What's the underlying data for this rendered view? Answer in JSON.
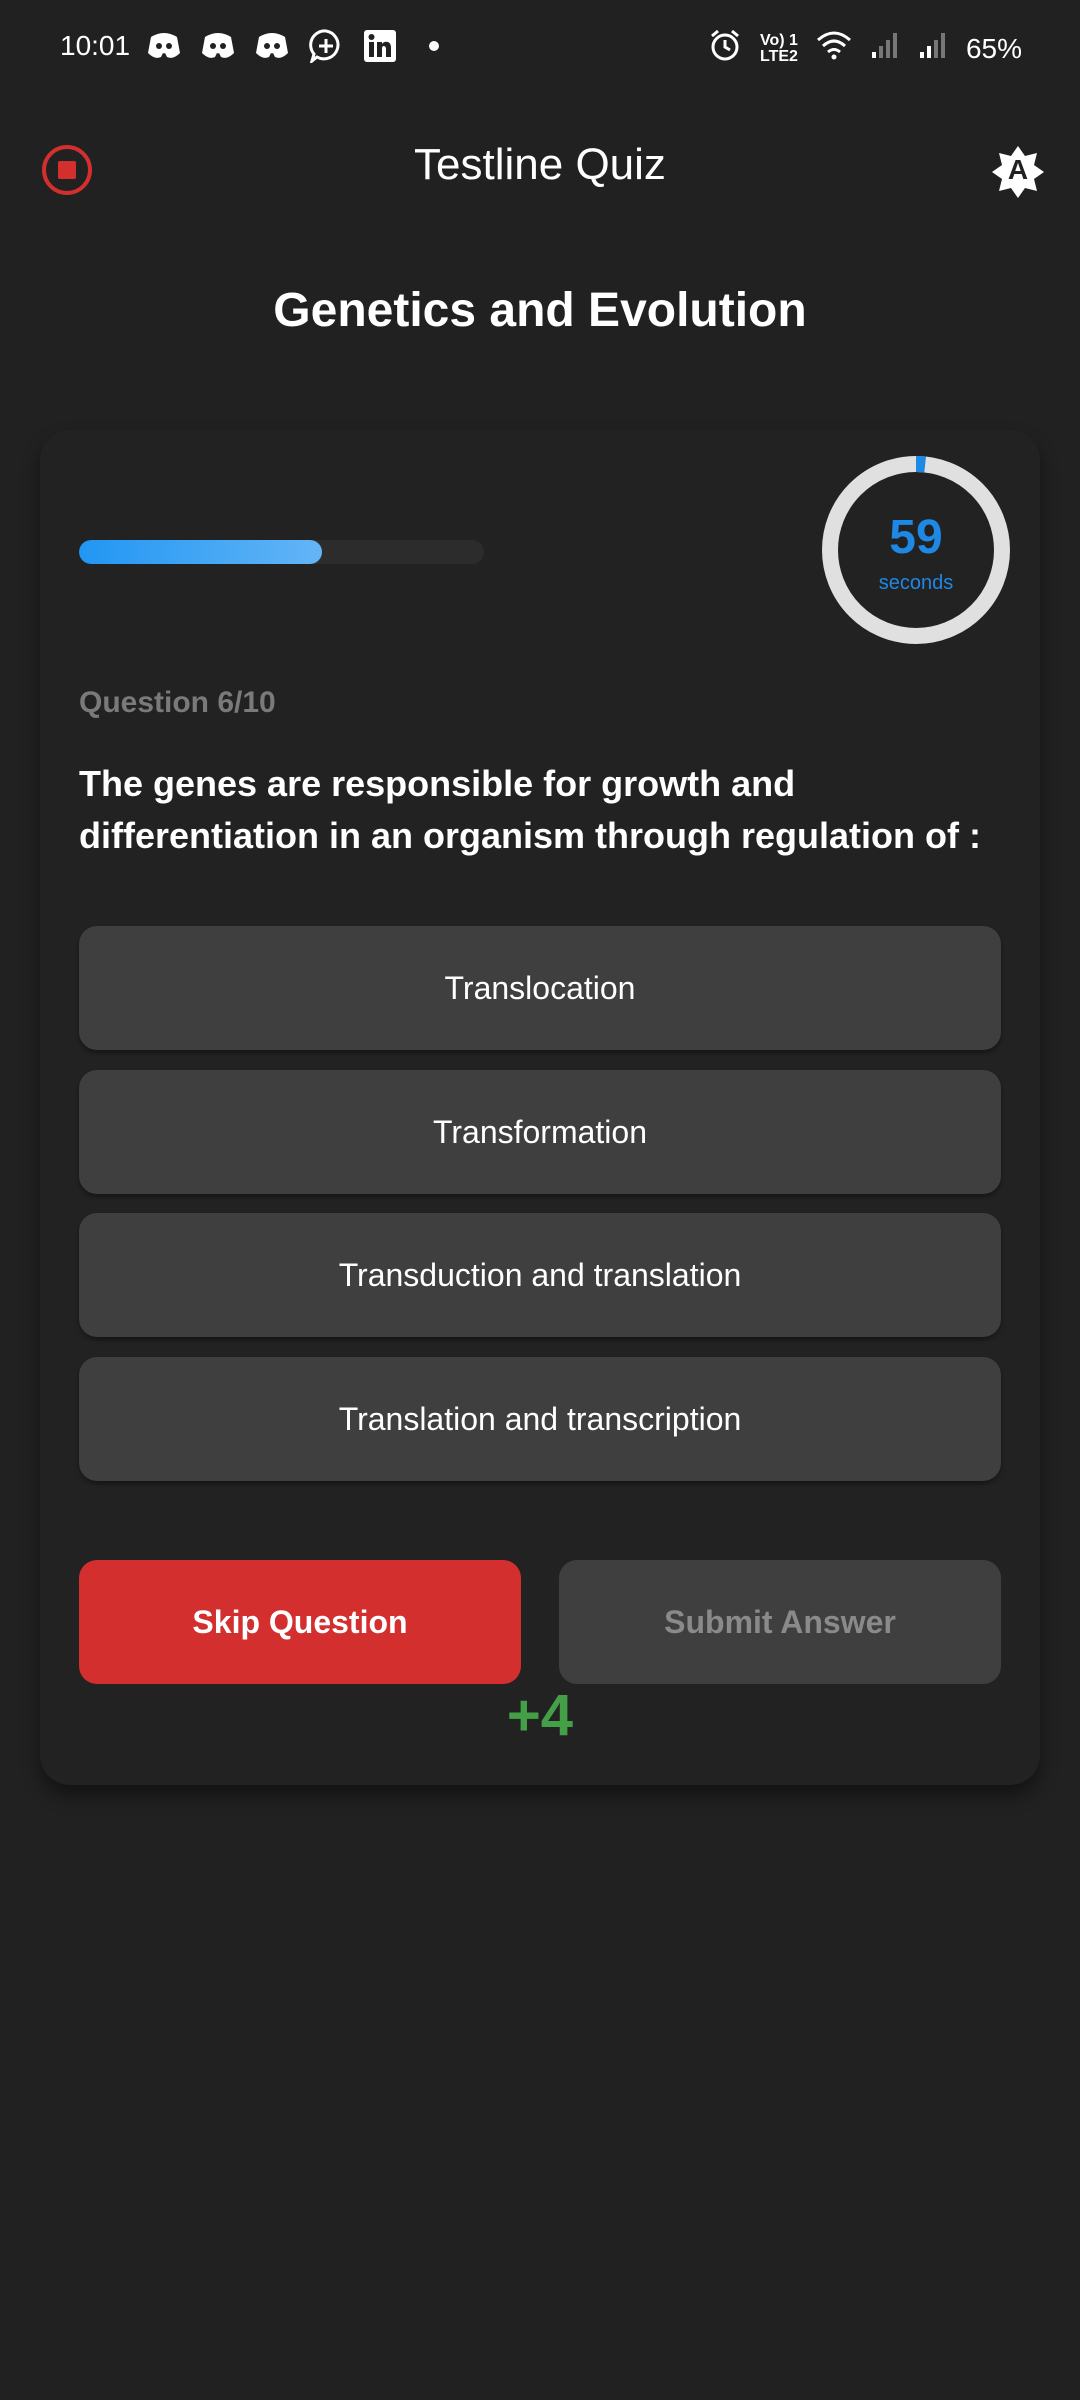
{
  "status_bar": {
    "time": "10:01",
    "lte_top": "Vo) 1",
    "lte_bottom": "LTE2",
    "battery": "65%"
  },
  "header": {
    "title": "Testline Quiz",
    "theme_label": "A"
  },
  "section_title": "Genetics and Evolution",
  "quiz": {
    "progress": 0.6,
    "timer_value": "59",
    "timer_unit": "seconds",
    "timer_fraction": 0.983,
    "question_number": "Question 6/10",
    "question_text": "The genes are responsible for growth and differentiation in an organism through regulation of :",
    "options": [
      {
        "label": "Translocation"
      },
      {
        "label": "Transformation"
      },
      {
        "label": "Transduction and translation"
      },
      {
        "label": "Translation and transcription"
      }
    ],
    "skip_label": "Skip Question",
    "submit_label": "Submit Answer",
    "points": "+4"
  },
  "colors": {
    "background": "#212121",
    "accent_blue": "#1e88e5",
    "danger_red": "#d32f2f",
    "success_green": "#43a047",
    "option_bg": "#3f3f3f"
  },
  "icons": {
    "left_status": [
      "discord-icon",
      "discord-icon",
      "discord-icon",
      "chat-plus-icon",
      "linkedin-icon",
      "dot-icon"
    ],
    "right_status": [
      "alarm-icon",
      "lte-icon",
      "wifi-icon",
      "signal-icon",
      "signal-icon"
    ]
  }
}
